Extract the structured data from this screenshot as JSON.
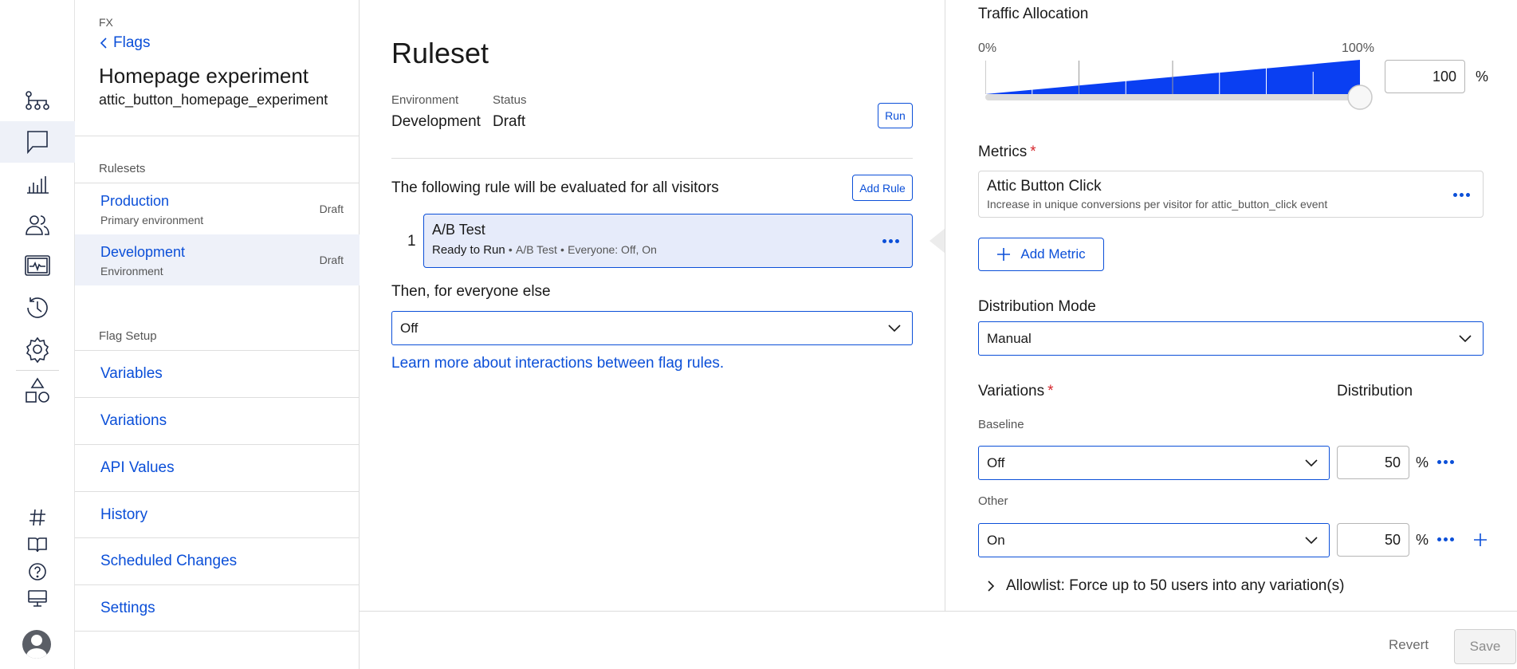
{
  "colors": {
    "accent": "#0b4fd8",
    "required": "#d6272d",
    "active_bg": "#eef1f9",
    "rule_bg": "#e6ebfa"
  },
  "rail": {
    "items": [
      "flow-icon",
      "flag-icon",
      "bar-chart-icon",
      "users-icon",
      "monitor-pulse-icon",
      "history-icon",
      "gear-icon",
      "shapes-icon"
    ],
    "bottom_items": [
      "hash-icon",
      "book-icon",
      "help-icon",
      "desktop-icon"
    ],
    "avatar": "avatar-icon"
  },
  "sidebar": {
    "product": "FX",
    "back_label": "Flags",
    "flag_name": "Homepage experiment",
    "flag_key": "attic_button_homepage_experiment",
    "rulesets_heading": "Rulesets",
    "environments": [
      {
        "name": "Production",
        "desc": "Primary environment",
        "status": "Draft"
      },
      {
        "name": "Development",
        "desc": "Environment",
        "status": "Draft"
      }
    ],
    "setup_heading": "Flag Setup",
    "setup_items": [
      "Variables",
      "Variations",
      "API Values",
      "History",
      "Scheduled Changes",
      "Settings"
    ]
  },
  "ruleset": {
    "title": "Ruleset",
    "environment_label": "Environment",
    "environment_value": "Development",
    "status_label": "Status",
    "status_value": "Draft",
    "run_label": "Run",
    "rules_heading": "The following rule will be evaluated for all visitors",
    "add_rule_label": "Add Rule",
    "rule": {
      "index": "1",
      "name": "A/B Test",
      "status": "Ready to Run",
      "type": "A/B Test",
      "audience": "Everyone: Off, On",
      "separator": "•"
    },
    "else_heading": "Then, for everyone else",
    "else_value": "Off",
    "learn_link": "Learn more about interactions between flag rules."
  },
  "config": {
    "traffic_label": "Traffic Allocation",
    "traffic_min": "0%",
    "traffic_max": "100%",
    "traffic_value": "100",
    "traffic_fraction": 1.0,
    "percent_sign": "%",
    "metrics_label": "Metrics",
    "required_mark": "*",
    "metric": {
      "name": "Attic Button Click",
      "desc": "Increase in unique conversions per visitor for attic_button_click event"
    },
    "add_metric_label": "Add Metric",
    "distribution_mode_label": "Distribution Mode",
    "distribution_mode_value": "Manual",
    "variations_label": "Variations",
    "distribution_label": "Distribution",
    "variations": [
      {
        "group": "Baseline",
        "value": "Off",
        "distribution": "50"
      },
      {
        "group": "Other",
        "value": "On",
        "distribution": "50"
      }
    ],
    "allowlist_label": "Allowlist: Force up to 50 users into any variation(s)"
  },
  "footer": {
    "revert_label": "Revert",
    "save_label": "Save"
  }
}
